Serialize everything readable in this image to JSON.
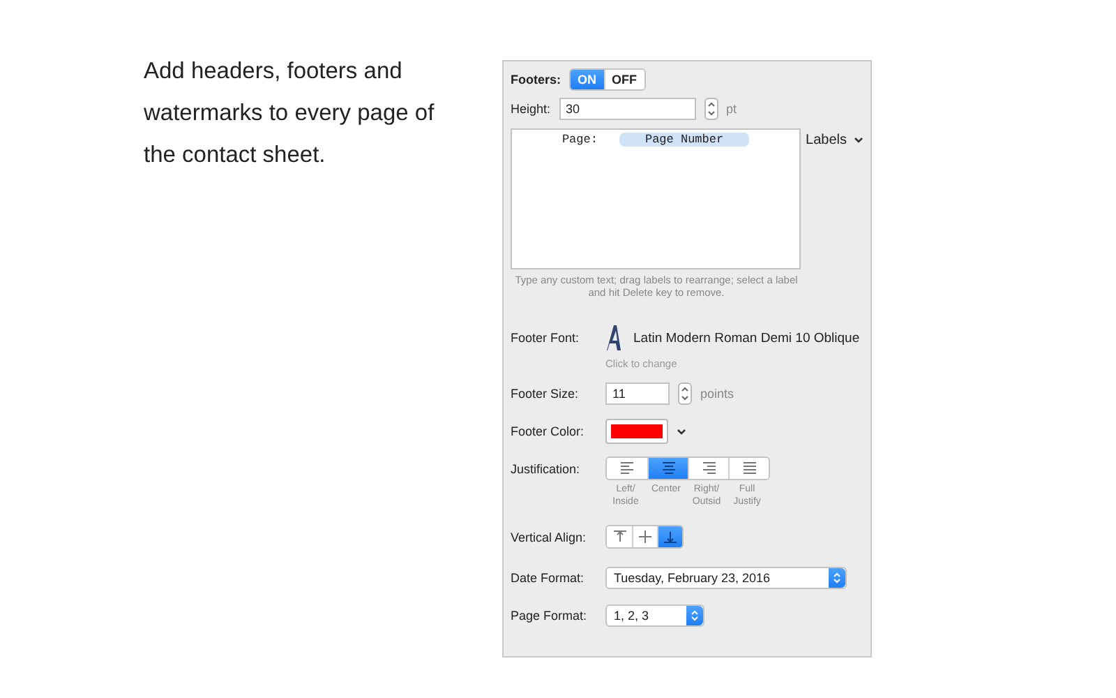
{
  "intro": "Add headers, footers and watermarks to every page of the contact sheet.",
  "footers": {
    "label": "Footers:",
    "options": [
      {
        "label": "ON",
        "selected": true
      },
      {
        "label": "OFF",
        "selected": false
      }
    ]
  },
  "height": {
    "label": "Height:",
    "value": "30",
    "unit": "pt"
  },
  "editor": {
    "tokens": [
      {
        "kind": "text",
        "text": "Page:"
      },
      {
        "kind": "label",
        "text": "Page Number"
      }
    ],
    "labels_menu": "Labels",
    "hint": "Type any custom text; drag labels to rearrange; select a label and hit Delete key to remove."
  },
  "footer_font": {
    "label": "Footer Font:",
    "value": "Latin Modern Roman Demi 10 Oblique",
    "hint": "Click to change"
  },
  "footer_size": {
    "label": "Footer Size:",
    "value": "11",
    "unit": "points"
  },
  "footer_color": {
    "label": "Footer Color:",
    "color": "#ff0000"
  },
  "justification": {
    "label": "Justification:",
    "options": [
      {
        "kind": "left",
        "caption": "Left/\nInside",
        "selected": false
      },
      {
        "kind": "center",
        "caption": "Center",
        "selected": true
      },
      {
        "kind": "right",
        "caption": "Right/\nOutsid",
        "selected": false
      },
      {
        "kind": "full",
        "caption": "Full\nJustify",
        "selected": false
      }
    ]
  },
  "vertical_align": {
    "label": "Vertical Align:",
    "options": [
      {
        "kind": "top",
        "selected": false
      },
      {
        "kind": "middle",
        "selected": false
      },
      {
        "kind": "bottom",
        "selected": true
      }
    ]
  },
  "date_format": {
    "label": "Date Format:",
    "value": "Tuesday, February 23, 2016"
  },
  "page_format": {
    "label": "Page Format:",
    "value": "1, 2, 3"
  }
}
